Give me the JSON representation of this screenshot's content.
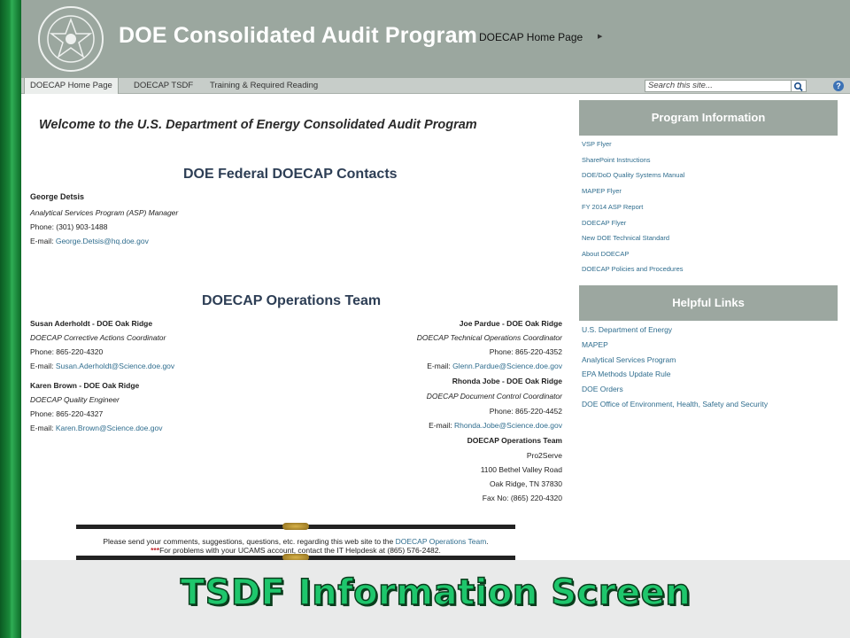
{
  "header": {
    "site_title": "DOE Consolidated Audit Program",
    "home_crumb": "DOECAP Home Page",
    "seal_icon": "doe-seal-icon"
  },
  "nav": {
    "tabs": [
      "DOECAP Home Page",
      "DOECAP TSDF",
      "Training & Required Reading"
    ],
    "search_placeholder": "Search this site...",
    "help_label": "?"
  },
  "main": {
    "welcome": "Welcome to the U.S. Department of Energy Consolidated Audit Program",
    "federal_heading": "DOE Federal DOECAP Contacts",
    "federal_contact": {
      "name": "George Detsis",
      "title": "Analytical Services Program (ASP) Manager",
      "phone": "Phone: (301) 903-1488",
      "email_label": "E-mail:",
      "email": "George.Detsis@hq.doe.gov"
    },
    "ops_heading": "DOECAP Operations Team",
    "left_contacts": [
      {
        "name": "Susan Aderholdt - DOE Oak Ridge",
        "title": "DOECAP Corrective Actions Coordinator",
        "phone": "Phone: 865-220-4320",
        "email_label": "E-mail:",
        "email": "Susan.Aderholdt@Science.doe.gov"
      },
      {
        "name": "Karen Brown - DOE Oak Ridge",
        "title": "DOECAP Quality Engineer",
        "phone": "Phone: 865-220-4327",
        "email_label": "E-mail:",
        "email": "Karen.Brown@Science.doe.gov"
      }
    ],
    "right_contacts": [
      {
        "name": "Joe Pardue - DOE Oak Ridge",
        "title": "DOECAP Technical Operations Coordinator",
        "phone": "Phone: 865-220-4352",
        "email_label": "E-mail:",
        "email": "Glenn.Pardue@Science.doe.gov"
      },
      {
        "name": "Rhonda Jobe - DOE Oak Ridge",
        "title": "DOECAP Document Control Coordinator",
        "phone": "Phone: 865-220-4452",
        "email_label": "E-mail:",
        "email": "Rhonda.Jobe@Science.doe.gov"
      }
    ],
    "ops_team_address": {
      "name": "DOECAP Operations Team",
      "company": "Pro2Serve",
      "street": "1100 Bethel Valley Road",
      "city": "Oak Ridge, TN 37830",
      "fax": "Fax No: (865) 220-4320"
    }
  },
  "sidebar": {
    "program_heading": "Program Information",
    "program_links": [
      "VSP Flyer",
      "SharePoint Instructions",
      "DOE/DoD Quality Systems Manual",
      "MAPEP Flyer",
      "FY 2014 ASP Report",
      "DOECAP Flyer",
      "New DOE Technical Standard",
      "About DOECAP",
      "DOECAP Policies and Procedures"
    ],
    "helpful_heading": "Helpful Links",
    "helpful_links": [
      "U.S. Department of Energy",
      "MAPEP",
      "Analytical Services Program",
      "EPA Methods Update Rule",
      "DOE Orders",
      "DOE Office of Environment, Health, Safety and Security"
    ]
  },
  "footer": {
    "comments_prefix": "Please send your comments, suggestions, questions, etc. regarding this web site to the",
    "comments_link": "DOECAP Operations Team",
    "comments_suffix": ".",
    "stars": "***",
    "ucams_text": "For problems with your UCAMS account, contact the IT Helpdesk at (865) 576-2482."
  },
  "caption": "TSDF Information Screen",
  "colors": {
    "header_bg": "#9ba79f",
    "link": "#2f6d8e",
    "heading": "#2d3e55",
    "caption": "#1ec66c",
    "accent_bar": "#1a8a3a"
  }
}
